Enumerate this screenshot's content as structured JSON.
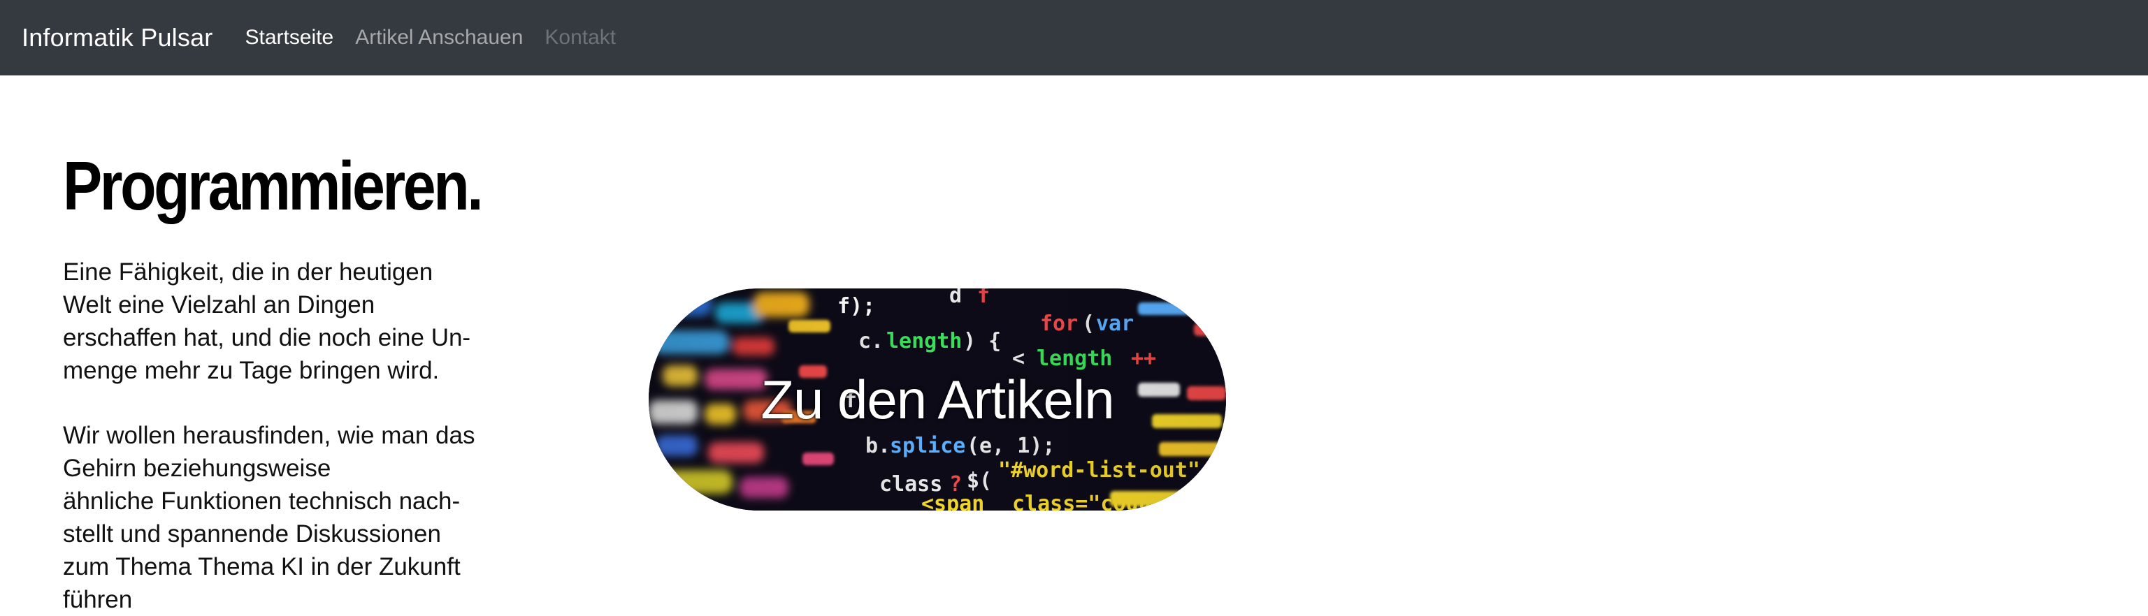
{
  "navbar": {
    "brand": "Informatik Pulsar",
    "links": [
      {
        "label": "Startseite",
        "state": "active"
      },
      {
        "label": "Artikel Anschauen",
        "state": "normal"
      },
      {
        "label": "Kontakt",
        "state": "disabled"
      }
    ],
    "background": "#343a40"
  },
  "main": {
    "title": "Programmieren.",
    "paragraph1": [
      "Eine Fähigkeit, die in der heutigen",
      "Welt eine Vielzahl an Dingen",
      "erschaffen hat, und die noch eine Un-",
      "menge mehr zu Tage bringen wird."
    ],
    "paragraph2": [
      "Wir wollen herausfinden, wie man das",
      "Gehirn beziehungsweise",
      "ähnliche Funktionen technisch nach-",
      "stellt und spannende Diskussionen",
      "zum Thema  Thema KI in der Zukunft",
      "führen"
    ],
    "hero_button": {
      "label": "Zu den Artikeln",
      "image": "code-screen-image",
      "code_snippets": [
        "f);",
        "d",
        "for",
        "c.length",
        "var",
        "length",
        "b.splice(e, 1);",
        "class",
        "#word-list-out",
        "class=\"count-word-list",
        "span"
      ]
    }
  }
}
